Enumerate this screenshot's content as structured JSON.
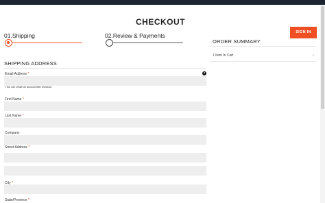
{
  "page": {
    "title": "CHECKOUT",
    "sign_in_label": "SIGN IN"
  },
  "steps": [
    {
      "label": "01.Shipping",
      "active": true
    },
    {
      "label": "02.Review & Payments",
      "active": false
    }
  ],
  "order_summary": {
    "title": "ORDER SUMMARY",
    "items_in_cart": "1 Item In Cart"
  },
  "shipping": {
    "title": "SHIPPING ADDRESS",
    "email_label": "Email Address",
    "email_note": "You can create an account after checkout.",
    "email_value": "",
    "first_name_label": "First Name",
    "first_name_value": "",
    "last_name_label": "Last Name",
    "last_name_value": "",
    "company_label": "Company",
    "company_value": "",
    "street_label": "Street Address",
    "street_line1_value": "",
    "street_line2_value": "",
    "city_label": "City",
    "city_value": "",
    "state_label": "State/Province",
    "required_marker": "*",
    "help_icon_text": "?"
  },
  "colors": {
    "accent": "#f04e23",
    "topbar": "#1d2533",
    "field_bg": "#eeeeee"
  }
}
